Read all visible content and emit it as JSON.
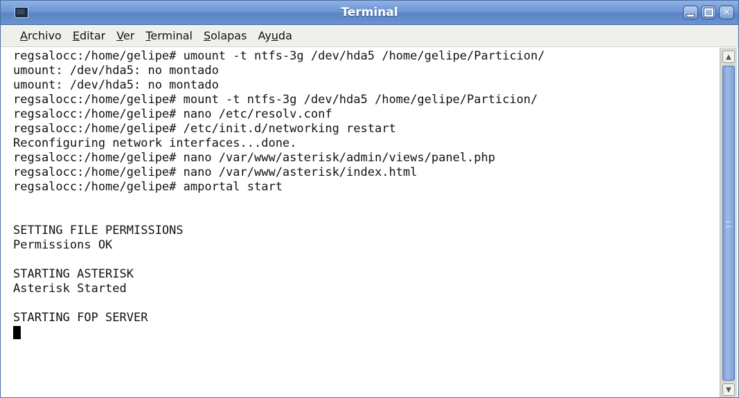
{
  "window": {
    "title": "Terminal",
    "accent_color": "#6f96d3"
  },
  "menu": [
    {
      "mnemonic": "A",
      "rest": "rchivo"
    },
    {
      "mnemonic": "E",
      "rest": "ditar"
    },
    {
      "mnemonic": "V",
      "rest": "er"
    },
    {
      "mnemonic": "T",
      "rest": "erminal"
    },
    {
      "mnemonic": "S",
      "rest": "olapas"
    },
    {
      "pre": "Ay",
      "mnemonic": "u",
      "rest": "da"
    }
  ],
  "terminal": {
    "lines": [
      "regsalocc:/home/gelipe# umount -t ntfs-3g /dev/hda5 /home/gelipe/Particion/",
      "umount: /dev/hda5: no montado",
      "umount: /dev/hda5: no montado",
      "regsalocc:/home/gelipe# mount -t ntfs-3g /dev/hda5 /home/gelipe/Particion/",
      "regsalocc:/home/gelipe# nano /etc/resolv.conf",
      "regsalocc:/home/gelipe# /etc/init.d/networking restart",
      "Reconfiguring network interfaces...done.",
      "regsalocc:/home/gelipe# nano /var/www/asterisk/admin/views/panel.php",
      "regsalocc:/home/gelipe# nano /var/www/asterisk/index.html",
      "regsalocc:/home/gelipe# amportal start",
      "",
      "",
      "SETTING FILE PERMISSIONS",
      "Permissions OK",
      "",
      "STARTING ASTERISK",
      "Asterisk Started",
      "",
      "STARTING FOP SERVER"
    ]
  }
}
